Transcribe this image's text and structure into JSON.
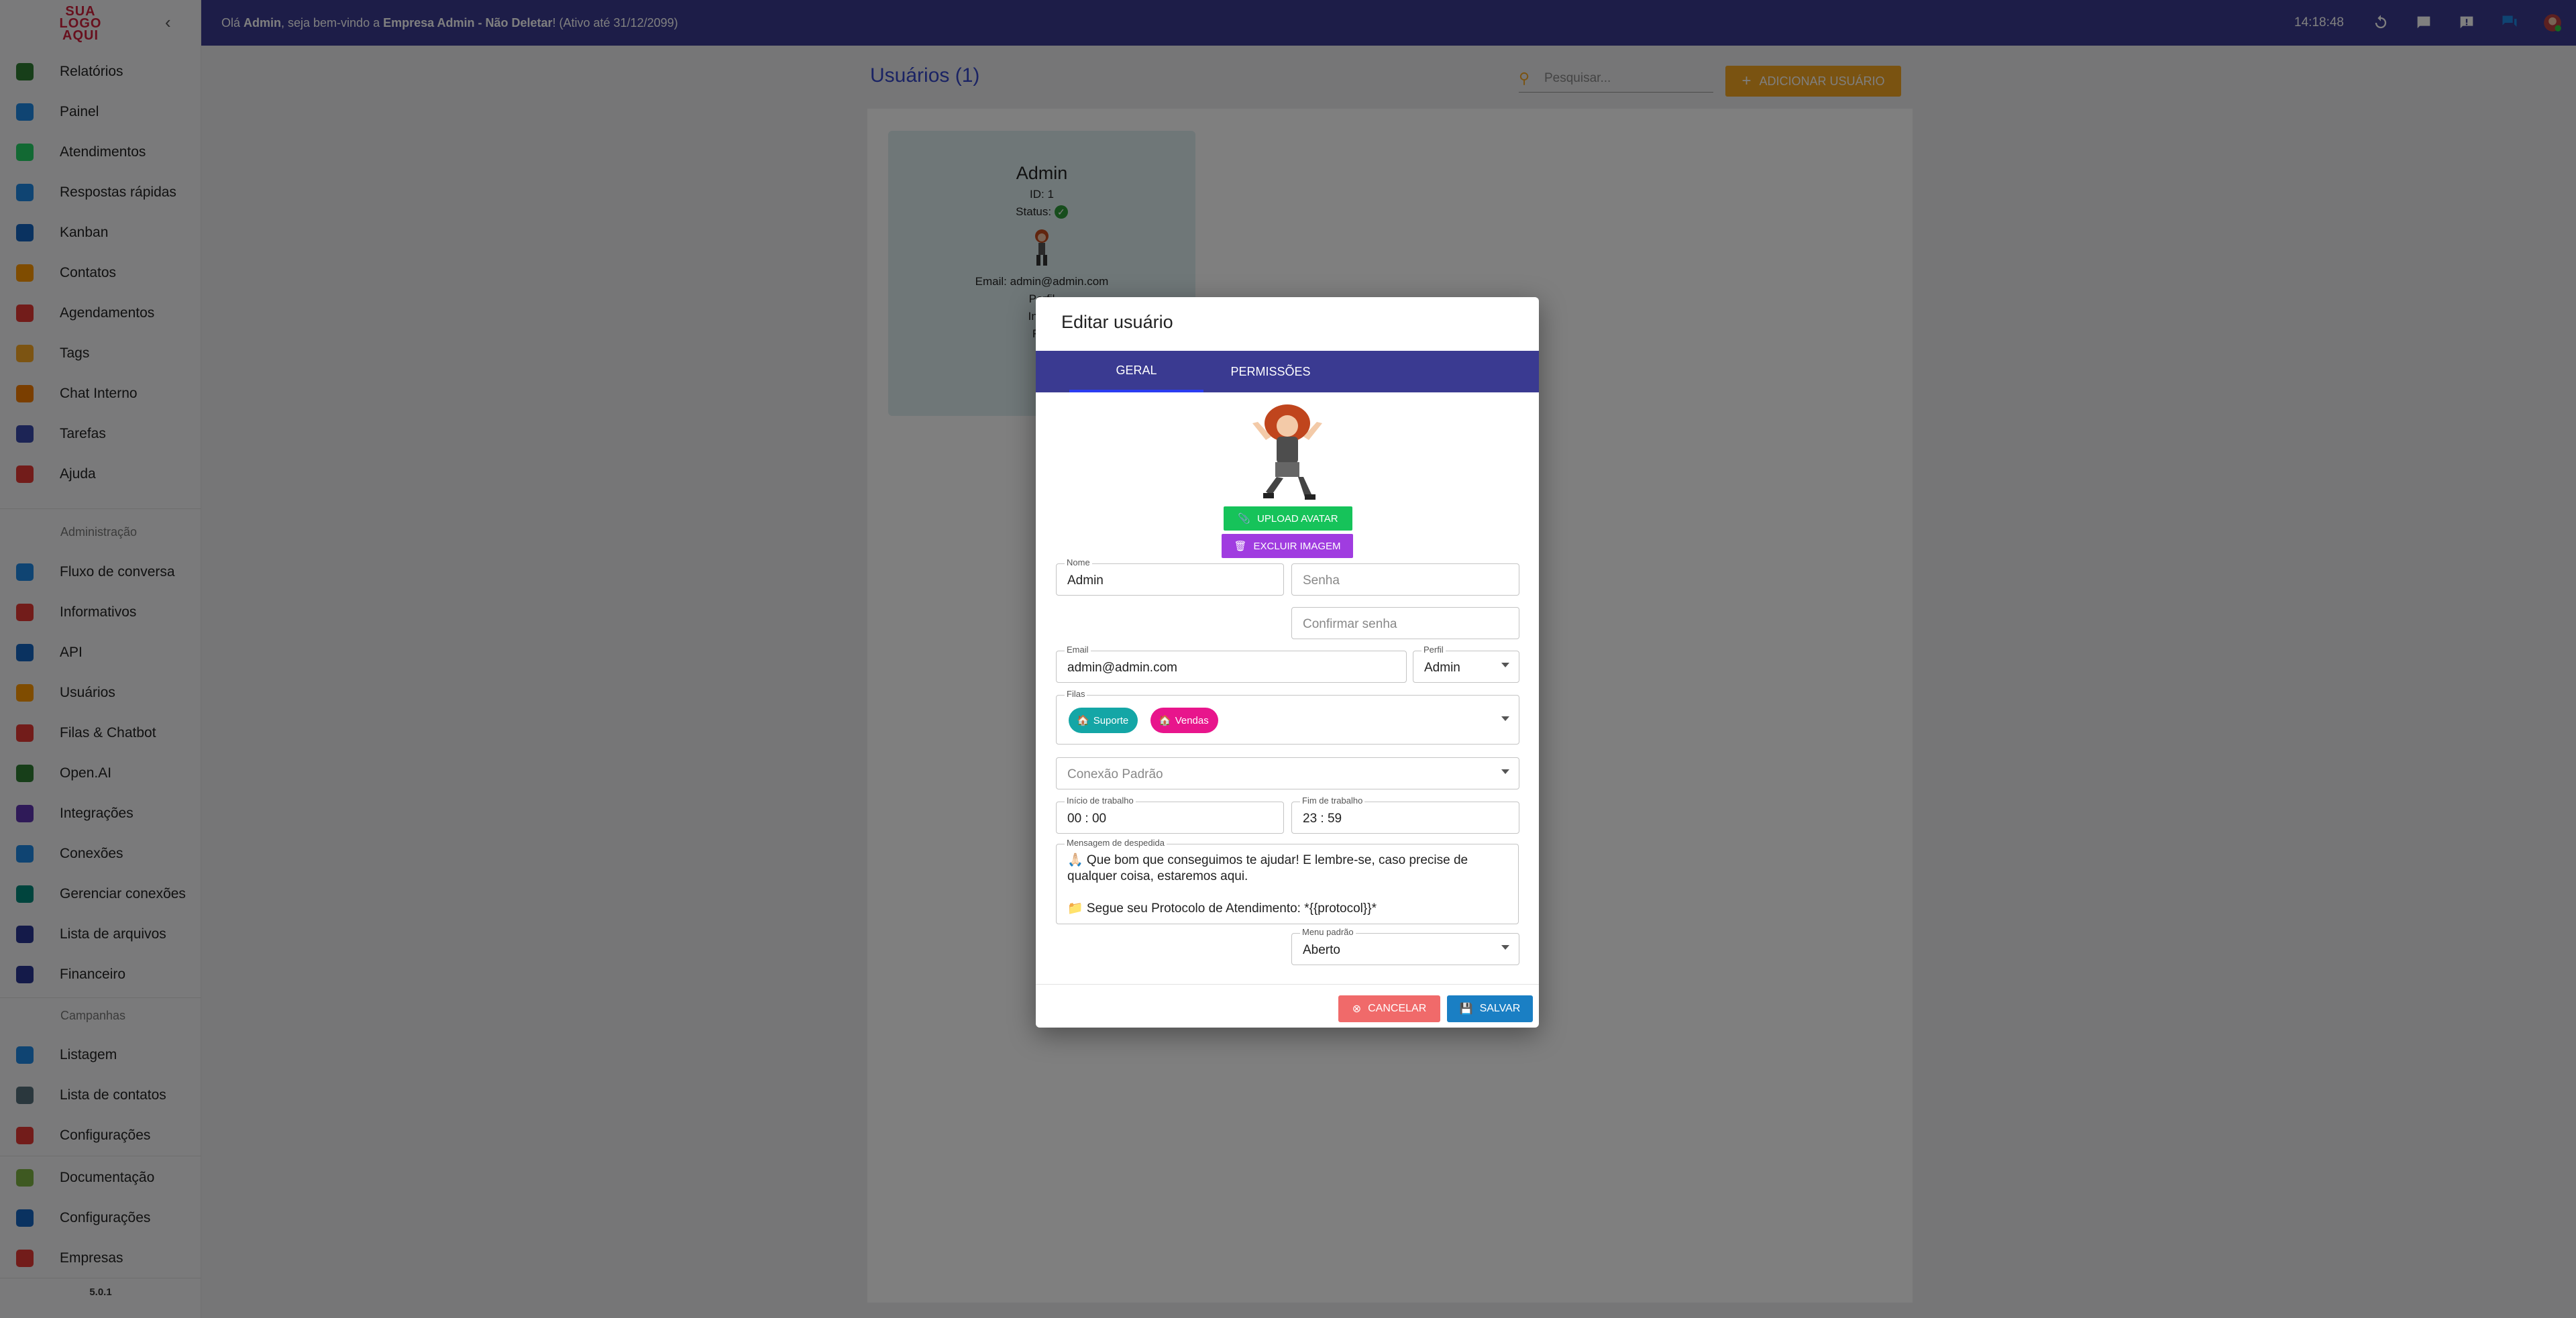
{
  "sidebar": {
    "logo_text": "SUA LOGO AQUI",
    "collapse_icon": "chevron-left-icon",
    "items": [
      {
        "label": "Relatórios",
        "icon": "report-icon",
        "color": "#2e7d32"
      },
      {
        "label": "Painel",
        "icon": "grid-icon",
        "color": "#1e88e5"
      },
      {
        "label": "Atendimentos",
        "icon": "whatsapp-icon",
        "color": "#25d366"
      },
      {
        "label": "Respostas rápidas",
        "icon": "stack-icon",
        "color": "#1e88e5"
      },
      {
        "label": "Kanban",
        "icon": "trello-icon",
        "color": "#1565c0"
      },
      {
        "label": "Contatos",
        "icon": "contacts-icon",
        "color": "#ff9800"
      },
      {
        "label": "Agendamentos",
        "icon": "calendar-icon",
        "color": "#e53935"
      },
      {
        "label": "Tags",
        "icon": "tag-icon",
        "color": "#f9a825"
      },
      {
        "label": "Chat Interno",
        "icon": "chat-icon",
        "color": "#f57c00"
      },
      {
        "label": "Tarefas",
        "icon": "tasks-icon",
        "color": "#3949ab"
      },
      {
        "label": "Ajuda",
        "icon": "youtube-icon",
        "color": "#e53935"
      }
    ],
    "admin_section": "Administração",
    "admin_items": [
      {
        "label": "Fluxo de conversa",
        "icon": "flow-icon",
        "color": "#1e88e5"
      },
      {
        "label": "Informativos",
        "icon": "calendar-icon",
        "color": "#e53935"
      },
      {
        "label": "API",
        "icon": "api-icon",
        "color": "#1565c0"
      },
      {
        "label": "Usuários",
        "icon": "user-icon",
        "color": "#ff9800"
      },
      {
        "label": "Filas & Chatbot",
        "icon": "share-icon",
        "color": "#e53935"
      },
      {
        "label": "Open.AI",
        "icon": "openai-icon",
        "color": "#2e7d32"
      },
      {
        "label": "Integrações",
        "icon": "integration-icon",
        "color": "#5e35b1"
      },
      {
        "label": "Conexões",
        "icon": "wifi-icon",
        "color": "#1e88e5"
      },
      {
        "label": "Gerenciar conexões",
        "icon": "settings-icon",
        "color": "#00897b"
      },
      {
        "label": "Lista de arquivos",
        "icon": "files-icon",
        "color": "#283593"
      },
      {
        "label": "Financeiro",
        "icon": "qrcode-icon",
        "color": "#283593"
      }
    ],
    "campaign_section": "Campanhas",
    "campaign_items": [
      {
        "label": "Listagem",
        "icon": "mailbox-icon",
        "color": "#1e88e5"
      },
      {
        "label": "Lista de contatos",
        "icon": "list-icon",
        "color": "#546e7a"
      },
      {
        "label": "Configurações",
        "icon": "gears-icon",
        "color": "#e53935"
      }
    ],
    "bottom_items": [
      {
        "label": "Documentação",
        "icon": "document-icon",
        "color": "#7cb342"
      },
      {
        "label": "Configurações",
        "icon": "gear-icon",
        "color": "#1565c0"
      },
      {
        "label": "Empresas",
        "icon": "home-icon",
        "color": "#e53935"
      }
    ],
    "version": "5.0.1"
  },
  "topbar": {
    "greeting_pre": "Olá ",
    "user": "Admin",
    "greeting_mid": ", seja bem-vindo a ",
    "company": "Empresa Admin - Não Deletar",
    "greeting_post": "! (Ativo até 31/12/2099)",
    "clock": "14:18:48",
    "icons": [
      "refresh-icon",
      "chat-icon",
      "feedback-icon",
      "forum-icon",
      "avatar-icon"
    ]
  },
  "page": {
    "title": "Usuários (1)",
    "search_placeholder": "Pesquisar...",
    "add_button": "ADICIONAR USUÁRIO"
  },
  "user_card": {
    "name": "Admin",
    "id": "ID: 1",
    "status": "Status:",
    "email": "Email: admin@admin.com",
    "profile": "Perfil",
    "start": "Início",
    "end": "Fim"
  },
  "dialog": {
    "title": "Editar usuário",
    "tabs": [
      "GERAL",
      "PERMISSÕES"
    ],
    "upload_avatar": "UPLOAD AVATAR",
    "delete_image": "EXCLUIR IMAGEM",
    "name_label": "Nome",
    "name_value": "Admin",
    "password_placeholder": "Senha",
    "confirm_password_placeholder": "Confirmar senha",
    "email_label": "Email",
    "email_value": "admin@admin.com",
    "profile_label": "Perfil",
    "profile_value": "Admin",
    "queues_label": "Filas",
    "queues": [
      {
        "label": "Suporte",
        "icon": "🏠",
        "color": "#14a6a6"
      },
      {
        "label": "Vendas",
        "icon": "🏠",
        "color": "#e8158c"
      }
    ],
    "default_connection_placeholder": "Conexão Padrão",
    "work_start_label": "Início de trabalho",
    "work_start_value": "00 : 00",
    "work_end_label": "Fim de trabalho",
    "work_end_value": "23 : 59",
    "farewell_label": "Mensagem de despedida",
    "farewell_line1": "🙏🏻 Que bom que conseguimos te ajudar! E lembre-se, caso precise de qualquer coisa, estaremos aqui.",
    "farewell_line2": "📁 Segue seu Protocolo de Atendimento: *{{protocol}}*",
    "menu_label": "Menu padrão",
    "menu_value": "Aberto",
    "cancel": "CANCELAR",
    "save": "SALVAR"
  }
}
